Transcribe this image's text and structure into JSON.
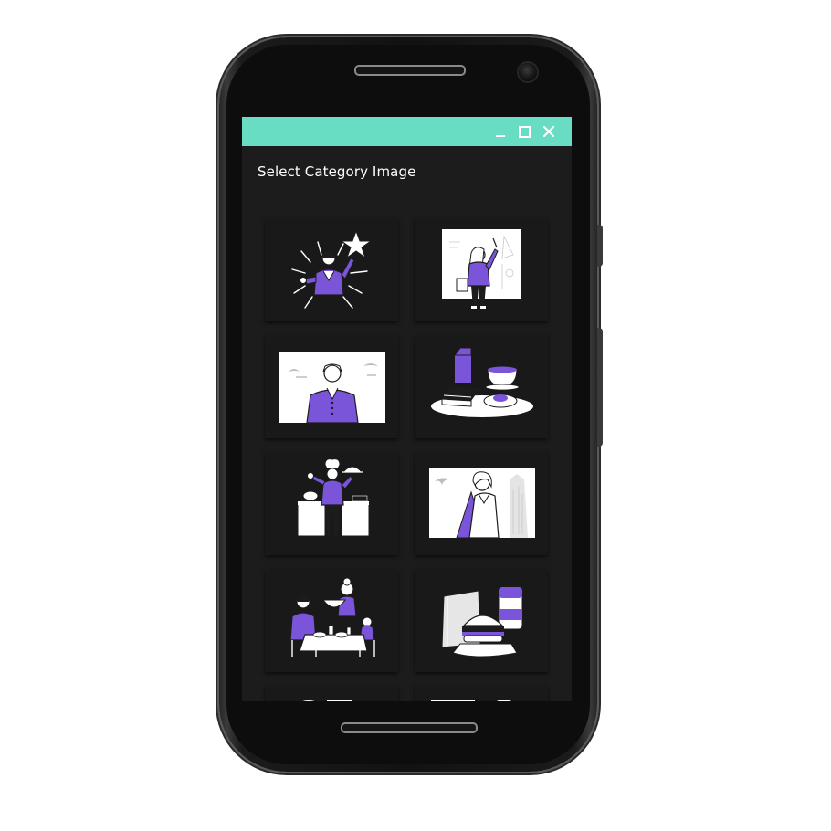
{
  "window": {
    "title_bar_color": "#69dcc4",
    "controls": [
      {
        "name": "minimize",
        "icon": "minimize-icon"
      },
      {
        "name": "maximize",
        "icon": "maximize-icon"
      },
      {
        "name": "close",
        "icon": "close-icon"
      }
    ]
  },
  "dialog": {
    "heading": "Select Category Image"
  },
  "accent_color": "#7b55d9",
  "category_images": [
    {
      "illustration": "achievement-star-illustration"
    },
    {
      "illustration": "presentation-whiteboard-illustration"
    },
    {
      "illustration": "portrait-scene-illustration"
    },
    {
      "illustration": "breakfast-illustration"
    },
    {
      "illustration": "chef-cooking-illustration"
    },
    {
      "illustration": "hero-cape-illustration"
    },
    {
      "illustration": "family-dinner-illustration"
    },
    {
      "illustration": "burger-takeaway-illustration"
    },
    {
      "illustration": "partial-illustration"
    },
    {
      "illustration": "partial-illustration"
    }
  ]
}
